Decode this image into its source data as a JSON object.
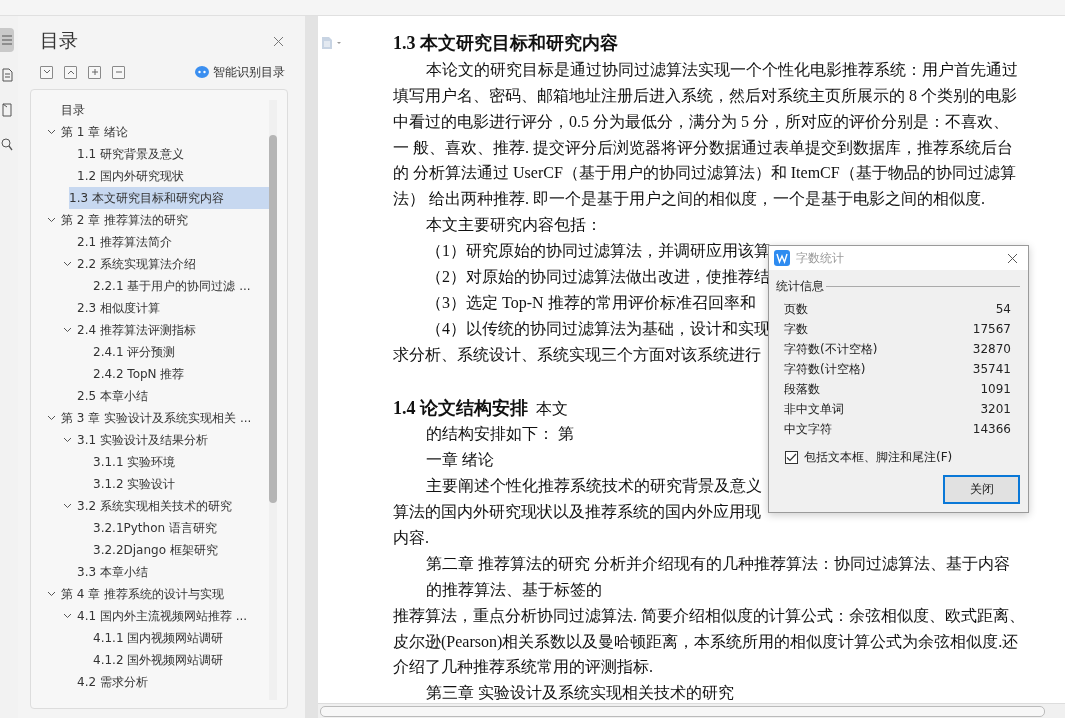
{
  "left_rail": {
    "items": [
      {
        "selected": true
      },
      {
        "selected": false
      },
      {
        "selected": false
      },
      {
        "selected": false
      }
    ]
  },
  "toc": {
    "title": "目录",
    "smart_button": "智能识别目录",
    "items": [
      {
        "label": "目录",
        "selected": false
      },
      {
        "label": "第 1 章 绪论",
        "selected": false,
        "expanded": true,
        "children": [
          {
            "label": "1.1 研究背景及意义",
            "selected": false
          },
          {
            "label": "1.2 国内外研究现状",
            "selected": false
          },
          {
            "label": "1.3 本文研究目标和研究内容",
            "selected": true
          }
        ]
      },
      {
        "label": "第 2 章 推荐算法的研究",
        "selected": false,
        "expanded": true,
        "children": [
          {
            "label": "2.1 推荐算法简介",
            "selected": false
          },
          {
            "label": "2.2 系统实现算法介绍",
            "selected": false,
            "expanded": true,
            "children": [
              {
                "label": "2.2.1 基于用户的协同过滤 ...",
                "selected": false
              }
            ]
          },
          {
            "label": "2.3 相似度计算",
            "selected": false
          },
          {
            "label": "2.4 推荐算法评测指标",
            "selected": false,
            "expanded": true,
            "children": [
              {
                "label": "2.4.1 评分预测",
                "selected": false
              },
              {
                "label": "2.4.2 TopN 推荐",
                "selected": false
              }
            ]
          },
          {
            "label": "2.5 本章小结",
            "selected": false
          }
        ]
      },
      {
        "label": "第 3 章 实验设计及系统实现相关 ...",
        "selected": false,
        "expanded": true,
        "children": [
          {
            "label": "3.1 实验设计及结果分析",
            "selected": false,
            "expanded": true,
            "children": [
              {
                "label": "3.1.1 实验环境",
                "selected": false
              },
              {
                "label": "3.1.2 实验设计",
                "selected": false
              }
            ]
          },
          {
            "label": "3.2 系统实现相关技术的研究",
            "selected": false,
            "expanded": true,
            "children": [
              {
                "label": "3.2.1Python 语言研究",
                "selected": false
              },
              {
                "label": "3.2.2Django 框架研究",
                "selected": false
              }
            ]
          },
          {
            "label": "3.3 本章小结",
            "selected": false
          }
        ]
      },
      {
        "label": "第 4 章 推荐系统的设计与实现",
        "selected": false,
        "expanded": true,
        "children": [
          {
            "label": "4.1 国内外主流视频网站推荐 ...",
            "selected": false,
            "expanded": true,
            "children": [
              {
                "label": "4.1.1 国内视频网站调研",
                "selected": false
              },
              {
                "label": "4.1.2 国外视频网站调研",
                "selected": false
              }
            ]
          },
          {
            "label": "4.2 需求分析",
            "selected": false
          }
        ]
      }
    ]
  },
  "document": {
    "lines": [
      {
        "kind": "heading",
        "text": "1.3  本文研究目标和研究内容"
      },
      {
        "kind": "indented",
        "text": "本论文的研究目标是通过协同过滤算法实现一个个性化电影推荐系统：用户首先通过"
      },
      {
        "kind": "plain",
        "text": "填写用户名、密码、邮箱地址注册后进入系统，然后对系统主页所展示的 8 个类别的电影"
      },
      {
        "kind": "plain",
        "text": "中看过的电影进行评分，0.5 分为最低分，满分为 5 分，所对应的评价分别是：不喜欢、"
      },
      {
        "kind": "plain",
        "text": "一 般、喜欢、推荐. 提交评分后浏览器将评分数据通过表单提交到数据库，推荐系统后台"
      },
      {
        "kind": "plain",
        "text": "的  分析算法通过 UserCF（基于用户的协同过滤算法）和 ItemCF（基于物品的协同过滤算"
      },
      {
        "kind": "plain",
        "text": "法）  给出两种推荐. 即一个是基于用户之间的相似度，一个是基于电影之间的相似度."
      },
      {
        "kind": "indented",
        "text": "本文主要研究内容包括："
      },
      {
        "kind": "indented",
        "text": "（1）研究原始的协同过滤算法，并调研应用该算"
      },
      {
        "kind": "indented",
        "text": "（2）对原始的协同过滤算法做出改进，使推荐结"
      },
      {
        "kind": "indented",
        "text": "（3）选定 Top-N 推荐的常用评价标准召回率和"
      },
      {
        "kind": "indented",
        "text": "（4）以传统的协同过滤算法为基础，设计和实现"
      },
      {
        "kind": "plain",
        "text": "求分析、系统设计、系统实现三个方面对该系统进行"
      },
      {
        "kind": "section",
        "text": "1.4 论文结构安排",
        "tail": "本文"
      },
      {
        "kind": "indented",
        "text": "的结构安排如下：  第"
      },
      {
        "kind": "indented",
        "text": "一章  绪论"
      },
      {
        "kind": "indented",
        "text": "主要阐述个性化推荐系统技术的研究背景及意义"
      },
      {
        "kind": "plain",
        "text": "算法的国内外研究现状以及推荐系统的国内外应用现"
      },
      {
        "kind": "plain",
        "text": "内容."
      },
      {
        "kind": "indented",
        "text": "第二章  推荐算法的研究  分析并介绍现有的几种推荐算法：协同过滤算法、基于内容"
      },
      {
        "kind": "indented",
        "text": "的推荐算法、基于标签的"
      },
      {
        "kind": "plain",
        "text": "推荐算法，重点分析协同过滤算法. 简要介绍相似度的计算公式：余弦相似度、欧式距离、"
      },
      {
        "kind": "plain",
        "text": "皮尔逊(Pearson)相关系数以及曼哈顿距离，本系统所用的相似度计算公式为余弦相似度.还"
      },
      {
        "kind": "plain",
        "text": "介绍了几种推荐系统常用的评测指标."
      },
      {
        "kind": "indented",
        "text": "第三章  实验设计及系统实现相关技术的研究"
      }
    ]
  },
  "dialog": {
    "title": "字数统计",
    "group": "统计信息",
    "stats": [
      {
        "label": "页数",
        "value": "54"
      },
      {
        "label": "字数",
        "value": "17567"
      },
      {
        "label": "字符数(不计空格)",
        "value": "32870"
      },
      {
        "label": "字符数(计空格)",
        "value": "35741"
      },
      {
        "label": "段落数",
        "value": "1091"
      },
      {
        "label": "非中文单词",
        "value": "3201"
      },
      {
        "label": "中文字符",
        "value": "14366"
      }
    ],
    "include_option": {
      "label": "包括文本框、脚注和尾注(F)",
      "checked": true
    },
    "close_button": "关闭"
  }
}
